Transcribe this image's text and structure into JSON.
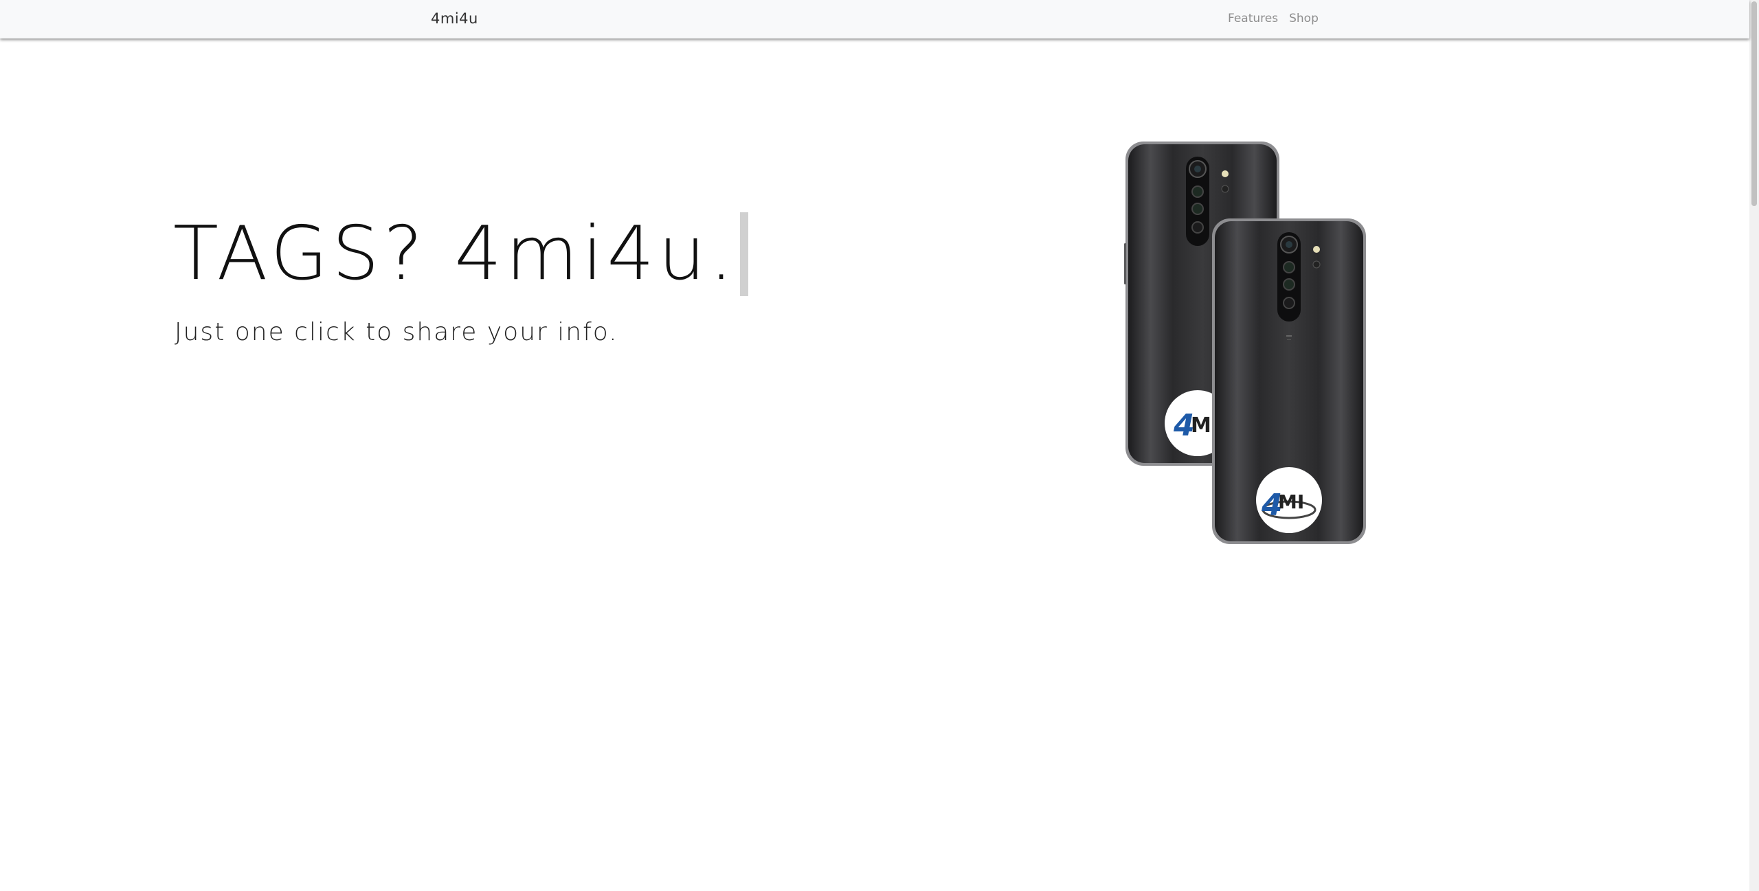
{
  "navbar": {
    "brand": "4mi4u",
    "links": [
      "Features",
      "Shop"
    ]
  },
  "hero": {
    "title": "TAGS? 4mi4u.",
    "subtitle": "Just one click to share your info.",
    "image_logo_text": "4MI"
  },
  "colors": {
    "navbar_bg": "#f8f9fa",
    "text_dark": "#111111",
    "link_gray": "#8e8e8e",
    "logo_blue": "#1e5aa8"
  }
}
